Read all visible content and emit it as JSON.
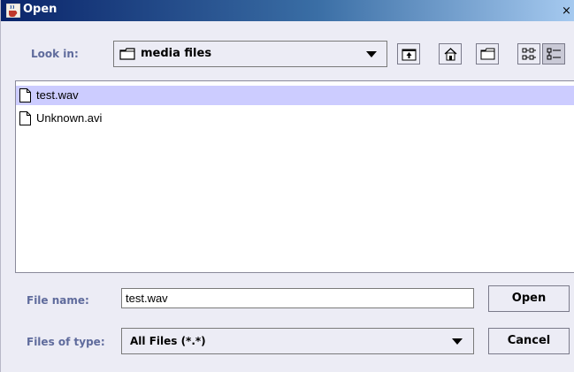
{
  "window": {
    "title": "Open",
    "close_glyph": "×"
  },
  "look_in": {
    "label": "Look in:",
    "value": "media files"
  },
  "toolbar": {
    "buttons": [
      "up-one-level-icon",
      "home-icon",
      "new-folder-icon",
      "list-view-icon",
      "details-view-icon"
    ]
  },
  "files": [
    {
      "name": "test.wav",
      "selected": true
    },
    {
      "name": "Unknown.avi",
      "selected": false
    }
  ],
  "file_name": {
    "label": "File name:",
    "value": "test.wav"
  },
  "files_of_type": {
    "label": "Files of type:",
    "value": "All Files (*.*)"
  },
  "buttons": {
    "open": "Open",
    "cancel": "Cancel"
  },
  "colors": {
    "label": "#5f6b9c",
    "selection": "#ccccff",
    "title_bar": "#0a246a"
  }
}
